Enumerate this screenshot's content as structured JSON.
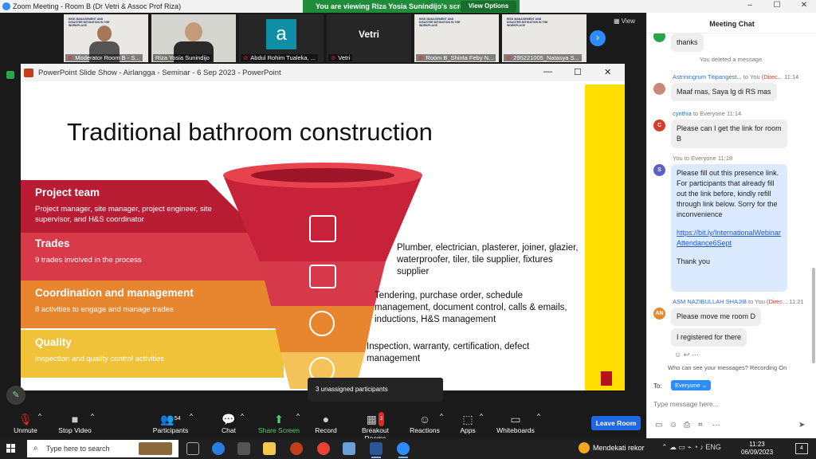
{
  "window": {
    "title": "Zoom Meeting - Room B (Dr Vetri & Assoc Prof Riza)",
    "controls": [
      "–",
      "☐",
      "✕"
    ]
  },
  "share_banner": {
    "message": "You are viewing Riza Yosia Sunindijo's screen",
    "view_options": "View Options"
  },
  "gallery": {
    "tiles": [
      {
        "label": "Moderator Room B - S...",
        "type": "doc"
      },
      {
        "label": "Riza Yosia Sunindijo",
        "type": "person"
      },
      {
        "label": "Abdul Rohim Tualeka, ...",
        "type": "avatar",
        "initial": "a"
      },
      {
        "label": "Vetri",
        "type": "name",
        "name": "Vetri"
      },
      {
        "label": "Room B_Shinta Feby N...",
        "type": "doc"
      },
      {
        "label": "295221005_Natasya S...",
        "type": "doc"
      }
    ],
    "mini_slide_text": "RISK MANAGEMENT AND DISASTER MITIGATION IN THE WORKPLACE",
    "view_label": "View",
    "next_icon": "›"
  },
  "ppt": {
    "window_title": "PowerPoint Slide Show  -  Airlangga - Seminar - 6 Sep 2023 - PowerPoint",
    "buttons": [
      "—",
      "☐",
      "✕"
    ],
    "slide": {
      "title": "Traditional bathroom construction",
      "bands": [
        {
          "heading": "Project team",
          "text": "Project manager, site manager, project engineer, site supervisor, and H&S coordinator",
          "color": "#b81d34"
        },
        {
          "heading": "Trades",
          "text": "9 trades involved in the process",
          "color": "#d93a4a"
        },
        {
          "heading": "Coordination and management",
          "text": "8 activities to engage and manage trades",
          "color": "#e8862f"
        },
        {
          "heading": "Quality",
          "text": "Inspection and quality control activities",
          "color": "#f0c23a"
        }
      ],
      "descriptions": [
        "Plumber, electrician, plasterer, joiner, glazier, waterproofer, tiler, tile supplier, fixtures supplier",
        "Tendering, purchase order, schedule management, document control, calls & emails, inductions, H&S management",
        "Inspection, warranty, certification, defect management"
      ]
    }
  },
  "tooltip": "3 unassigned participants",
  "toolbar": {
    "items": [
      {
        "label": "Unmute",
        "icon": "🎙"
      },
      {
        "label": "Stop Video",
        "icon": "■"
      },
      {
        "label": "Participants",
        "icon": "👥",
        "count": "54"
      },
      {
        "label": "Chat",
        "icon": "💬"
      },
      {
        "label": "Share Screen",
        "icon": "⬆"
      },
      {
        "label": "Record",
        "icon": "●"
      },
      {
        "label": "Breakout Rooms",
        "icon": "▦",
        "badge": "3"
      },
      {
        "label": "Reactions",
        "icon": "☺"
      },
      {
        "label": "Apps",
        "icon": "⬚"
      },
      {
        "label": "Whiteboards",
        "icon": "▭"
      }
    ],
    "leave": "Leave Room"
  },
  "chat": {
    "title": "Meeting Chat",
    "messages": {
      "m0": {
        "text": "thanks"
      },
      "deleted": "You deleted a message",
      "m1": {
        "sender": "Astriningrum Titipangest...",
        "to": " to You ",
        "dm": "(Direc...",
        "time": "11:14",
        "text": "Maaf mas, Saya lg di RS mas"
      },
      "m2": {
        "sender": "cynthia",
        "to": " to Everyone ",
        "time": "11:14",
        "text": "Please can I get the link for room B",
        "initial": "C"
      },
      "m3": {
        "sender": "You",
        "to": " to Everyone ",
        "time": "11:18",
        "text": "Please fill out this presence link. For participants that already fill out the link before, kindly refill through link below. Sorry for the inconvenience",
        "link": "https://bit.ly/InternationalWebinarAttendance6Sept",
        "thanks": "Thank you",
        "initial": "S"
      },
      "m4": {
        "sender": "ASM NAZIBULLAH SHAJIB",
        "to": " to You ",
        "dm": "(Direc...",
        "time": "11:21",
        "text": "Please move me room D",
        "text2": "I registered for there",
        "initial": "AN"
      }
    },
    "privacy": "Who can see your messages? Recording On",
    "to_label": "To:",
    "to_value": "Everyone ⌄",
    "input_placeholder": "Type message here..."
  },
  "taskbar": {
    "search_placeholder": "Type here to search",
    "weather": "Mendekati rekor",
    "time": "11:23",
    "date": "06/09/2023",
    "notif_count": "4"
  }
}
